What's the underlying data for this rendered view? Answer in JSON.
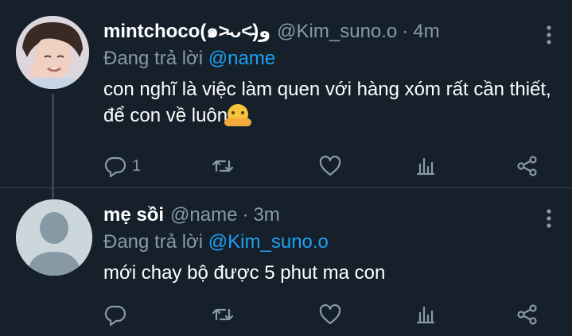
{
  "colors": {
    "background": "#15202b",
    "text_primary": "#ffffff",
    "text_secondary": "#8899a6",
    "link": "#1da1f2",
    "divider": "#38444d"
  },
  "tweets": [
    {
      "display_name": "mintchoco(๑˃̵ᴗ˂̵)و",
      "handle": "@Kim_suno.o",
      "separator": "·",
      "time": "4m",
      "reply_prefix": "Đang trả lời",
      "reply_to": "@name",
      "text": "con nghĩ là việc làm quen với hàng xóm rất cần thiết, để con về luôn",
      "emoji": "smiling-face-with-open-hands",
      "reply_count": "1",
      "icons": [
        "reply-icon",
        "retweet-icon",
        "like-icon",
        "stats-icon",
        "share-icon",
        "more-options-icon"
      ]
    },
    {
      "display_name": "mẹ sồi",
      "handle": "@name",
      "separator": "·",
      "time": "3m",
      "reply_prefix": "Đang trả lời",
      "reply_to": "@Kim_suno.o",
      "text": "mới chay bộ được 5 phut ma con",
      "reply_count": "",
      "icons": [
        "reply-icon",
        "retweet-icon",
        "like-icon",
        "stats-icon",
        "share-icon",
        "more-options-icon"
      ]
    }
  ]
}
